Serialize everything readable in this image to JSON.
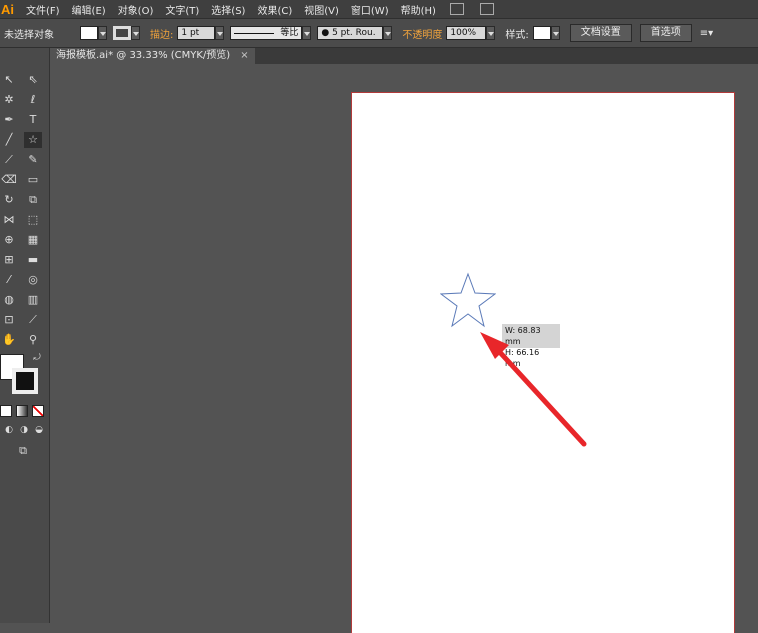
{
  "app": {
    "logo": "Ai"
  },
  "menu": {
    "items": [
      "文件(F)",
      "编辑(E)",
      "对象(O)",
      "文字(T)",
      "选择(S)",
      "效果(C)",
      "视图(V)",
      "窗口(W)",
      "帮助(H)"
    ]
  },
  "control": {
    "selection": "未选择对象",
    "stroke_label": "描边:",
    "stroke_weight": "1 pt",
    "stroke_profile": "等比",
    "brush": "● 5 pt. Rou.",
    "opacity_label": "不透明度",
    "opacity_value": "100%",
    "style_label": "样式:",
    "doc_setup": "文档设置",
    "preferences": "首选项"
  },
  "document": {
    "tab_title": "海报模板.ai* @ 33.33% (CMYK/预览)",
    "close": "×"
  },
  "tooltip": {
    "width": "W: 68.83 mm",
    "height": "H: 66.16 mm"
  },
  "colors": {
    "accent": "#ff9a00",
    "arrow": "#e8262a",
    "star_stroke": "#5b7ab8"
  }
}
